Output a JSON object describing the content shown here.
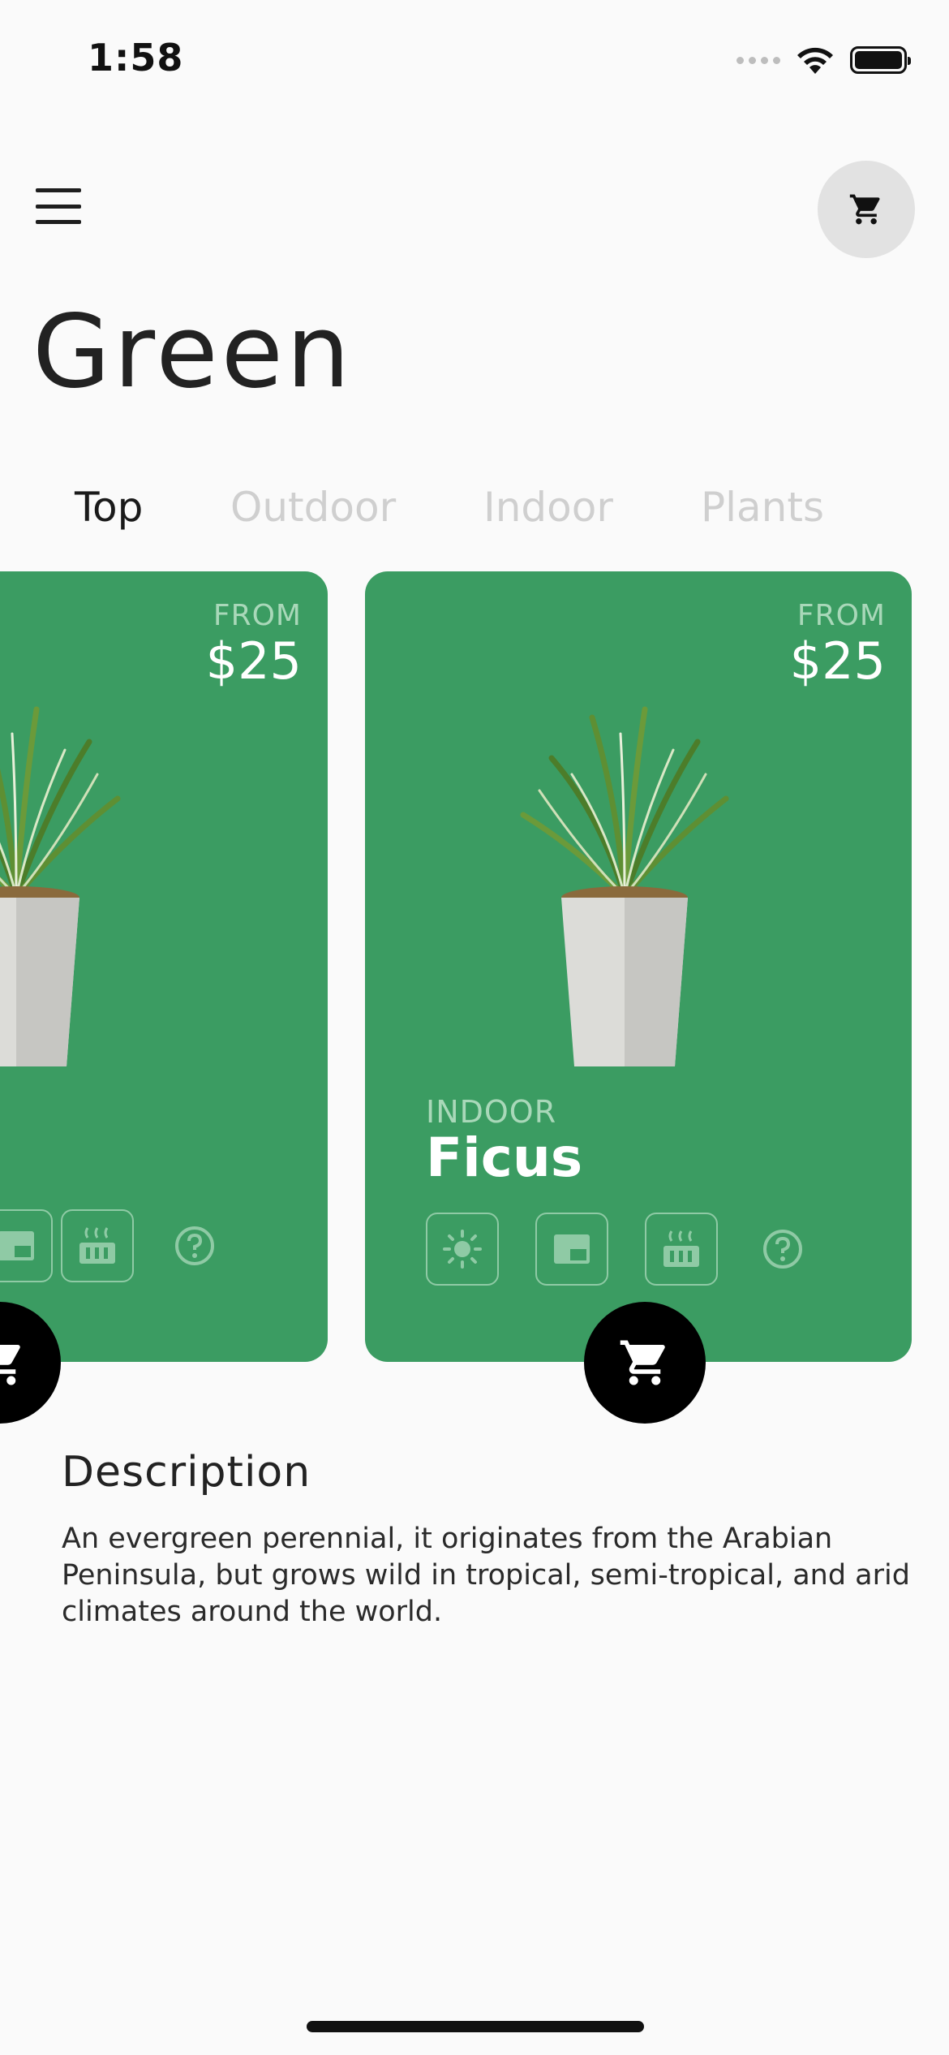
{
  "status_bar": {
    "time": "1:58"
  },
  "header": {
    "title": "Green"
  },
  "tabs": [
    {
      "label": "Top",
      "active": true
    },
    {
      "label": "Outdoor",
      "active": false
    },
    {
      "label": "Indoor",
      "active": false
    },
    {
      "label": "Plants",
      "active": false
    }
  ],
  "products": [
    {
      "from_label": "FROM",
      "price": "$25",
      "category": "",
      "name": ""
    },
    {
      "from_label": "FROM",
      "price": "$25",
      "category": "INDOOR",
      "name": "Ficus"
    }
  ],
  "features": [
    "sun-icon",
    "window-icon",
    "heater-icon",
    "help-circle-icon"
  ],
  "description": {
    "title": "Description",
    "body": "An evergreen perennial, it originates from the Arabian Peninsula, but grows wild in tropical, semi-tropical, and arid climates around the world."
  },
  "colors": {
    "card_green": "#3b9c62",
    "muted_text": "#a9d8b9",
    "inactive_tab": "#cfcfcf",
    "background": "#fafafa"
  }
}
